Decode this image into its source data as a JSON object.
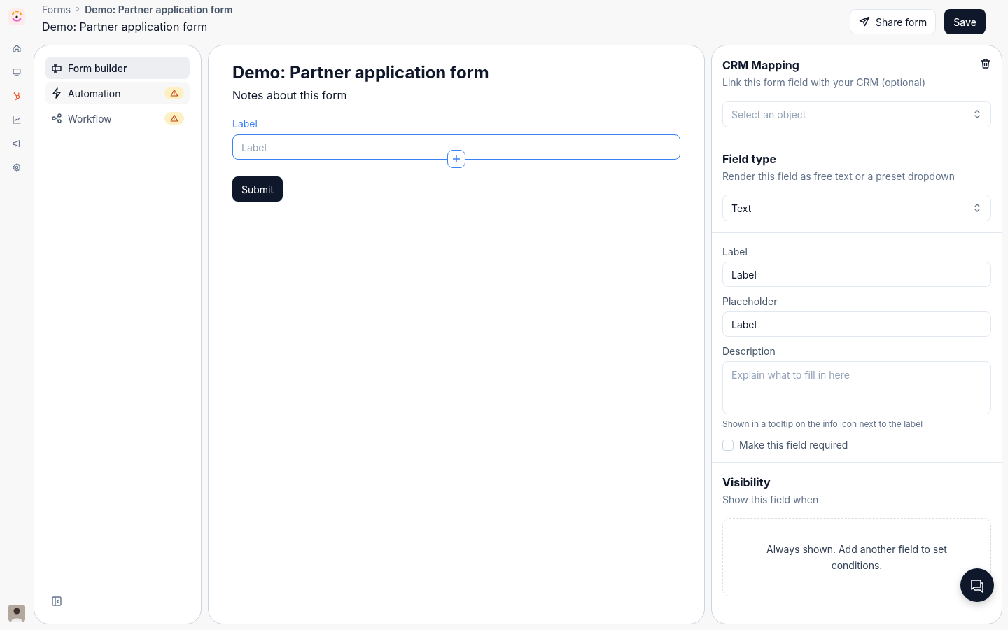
{
  "breadcrumb": {
    "parent": "Forms",
    "current": "Demo: Partner application form"
  },
  "page_title": "Demo: Partner application form",
  "header_buttons": [
    {
      "label": "Share form",
      "kind": "outline"
    },
    {
      "label": "Save",
      "kind": "primary"
    }
  ],
  "rail": [
    {
      "kind": "home"
    },
    {
      "kind": "monitor"
    },
    {
      "kind": "hub"
    },
    {
      "kind": "chart"
    },
    {
      "kind": "megaphone"
    },
    {
      "kind": "gear"
    }
  ],
  "nav": [
    {
      "label": "Form builder",
      "kind": "builder",
      "selected": true,
      "hovered": false,
      "warning": false
    },
    {
      "label": "Automation",
      "kind": "bolt",
      "selected": false,
      "hovered": true,
      "warning": true
    },
    {
      "label": "Workflow",
      "kind": "workflow",
      "selected": false,
      "hovered": false,
      "warning": true
    }
  ],
  "form": {
    "title": "Demo: Partner application form",
    "notes": "Notes about this form",
    "field_label": "Label",
    "field_placeholder": "Label",
    "submit": "Submit"
  },
  "settings": {
    "crm": {
      "title": "CRM Mapping",
      "subtitle": "Link this form field with your CRM (optional)",
      "placeholder": "Select an object"
    },
    "field_type": {
      "title": "Field type",
      "subtitle": "Render this field as free text or a preset dropdown",
      "value": "Text"
    },
    "label": {
      "label": "Label",
      "value": "Label"
    },
    "placeholder": {
      "label": "Placeholder",
      "value": "Label"
    },
    "description": {
      "label": "Description",
      "placeholder": "Explain what to fill in here",
      "help": "Shown in a tooltip on the info icon next to the label"
    },
    "required": {
      "label": "Make this field required",
      "checked": false
    },
    "visibility": {
      "title": "Visibility",
      "subtitle": "Show this field when",
      "empty": "Always shown. Add another field to set conditions."
    }
  }
}
